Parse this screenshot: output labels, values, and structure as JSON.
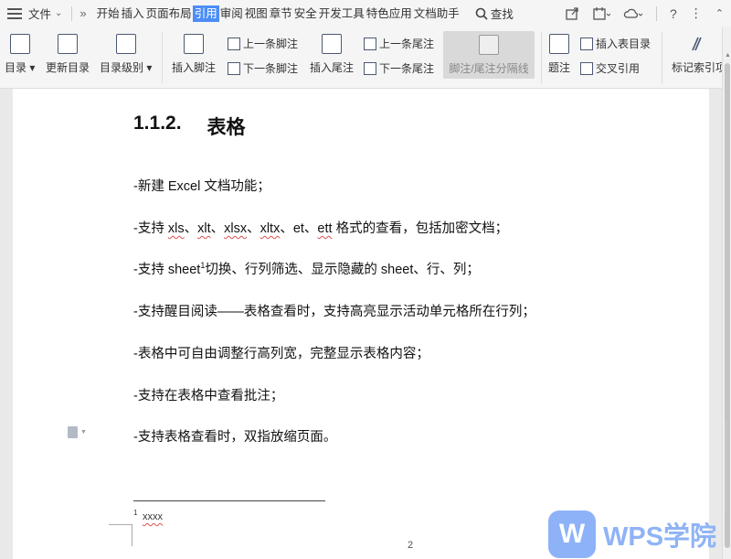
{
  "menu": {
    "file": "文件",
    "tabs": [
      "开始",
      "插入",
      "页面布局",
      "引用",
      "审阅",
      "视图",
      "章节",
      "安全",
      "开发工具",
      "特色应用",
      "文档助手"
    ],
    "active_tab": "引用",
    "search": "查找"
  },
  "ribbon": {
    "toc": "目录",
    "update_toc": "更新目录",
    "toc_level": "目录级别",
    "insert_footnote": "插入脚注",
    "prev_footnote": "上一条脚注",
    "next_footnote": "下一条脚注",
    "insert_endnote": "插入尾注",
    "prev_endnote": "上一条尾注",
    "next_endnote": "下一条尾注",
    "separator": "脚注/尾注分隔线",
    "caption": "题注",
    "insert_table_of_figures": "插入表目录",
    "cross_reference": "交叉引用",
    "mark_index": "标记索引项"
  },
  "document": {
    "heading_number": "1.1.2.",
    "heading_text": "表格",
    "lines": {
      "l1": "-新建 Excel 文档功能；",
      "l2_pre": "-支持 ",
      "l2_xls": "xls",
      "l2_s1": "、",
      "l2_xlt": "xlt",
      "l2_s2": "、",
      "l2_xlsx": "xlsx",
      "l2_s3": "、",
      "l2_xltx": "xltx",
      "l2_s4": "、et、",
      "l2_ett": "ett",
      "l2_post": " 格式的查看，包括加密文档；",
      "l3_pre": "-支持 sheet",
      "l3_sup": "1",
      "l3_post": "切换、行列筛选、显示隐藏的 sheet、行、列；",
      "l4": "-支持醒目阅读——表格查看时，支持高亮显示活动单元格所在行列；",
      "l5": "-表格中可自由调整行高列宽，完整显示表格内容；",
      "l6": "-支持在表格中查看批注；",
      "l7": "-支持表格查看时，双指放缩页面。"
    },
    "footnote_number": "1",
    "footnote_text": "xxxx",
    "page_number": "2"
  },
  "watermark": {
    "mark": "W",
    "text": "WPS学院"
  }
}
